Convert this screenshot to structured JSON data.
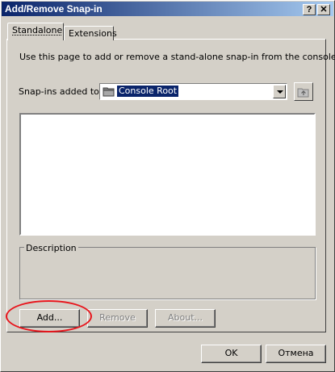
{
  "window": {
    "title": "Add/Remove Snap-in",
    "help_glyph": "?",
    "close_glyph": "✕"
  },
  "tabs": [
    {
      "label": "Standalone",
      "selected": true
    },
    {
      "label": "Extensions",
      "selected": false
    }
  ],
  "standalone": {
    "intro": "Use this page to add or remove a stand-alone snap-in from the console.",
    "snapins_label": "Snap-ins added to:",
    "snapins_value": "Console Root",
    "description_label": "Description"
  },
  "buttons": {
    "add": "Add...",
    "remove": "Remove",
    "about": "About...",
    "ok": "OK",
    "cancel": "Отмена"
  },
  "colors": {
    "face": "#d4d0c8",
    "title_start": "#0a246a",
    "title_end": "#a6caf0",
    "selection": "#0a246a",
    "annotation": "#e8141b"
  },
  "icons": {
    "combo_item": "folder-icon",
    "up_level": "folder-up-icon",
    "dropdown": "chevron-down-icon"
  }
}
